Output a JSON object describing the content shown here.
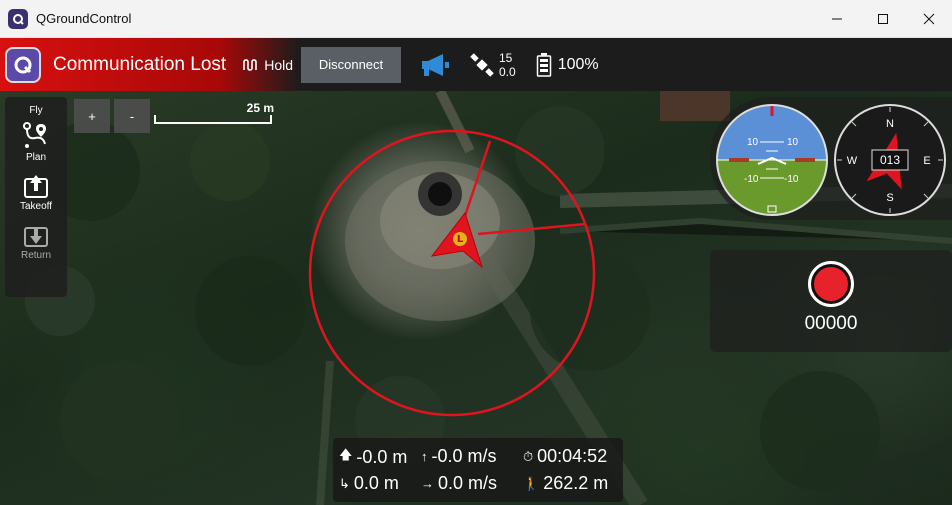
{
  "window": {
    "title": "QGroundControl"
  },
  "toolbar": {
    "status": "Communication Lost",
    "flight_mode": "Hold",
    "disconnect_label": "Disconnect",
    "gps_satellites": "15",
    "gps_hdop": "0.0",
    "battery": "100%"
  },
  "toolstrip": {
    "fly": "Fly",
    "plan": "Plan",
    "takeoff": "Takeoff",
    "return": "Return"
  },
  "map": {
    "zoom_in": "+",
    "zoom_out": "-",
    "scale_label": "25 m",
    "vehicle_marker": "L"
  },
  "attitude": {
    "pitch_labels": [
      "10",
      "10",
      "-10",
      "-10"
    ]
  },
  "compass": {
    "heading": "013",
    "n": "N",
    "s": "S",
    "e": "E",
    "w": "W"
  },
  "recorder": {
    "count": "00000"
  },
  "telemetry": {
    "altitude": "-0.0 m",
    "vertical_speed": "-0.0 m/s",
    "flight_time": "00:04:52",
    "distance": "0.0 m",
    "ground_speed": "0.0 m/s",
    "home_distance": "262.2 m"
  },
  "colors": {
    "alert_red": "#d81010",
    "geofence": "#e0141e",
    "sky": "#5b8fd6",
    "ground": "#6b9a2c"
  }
}
